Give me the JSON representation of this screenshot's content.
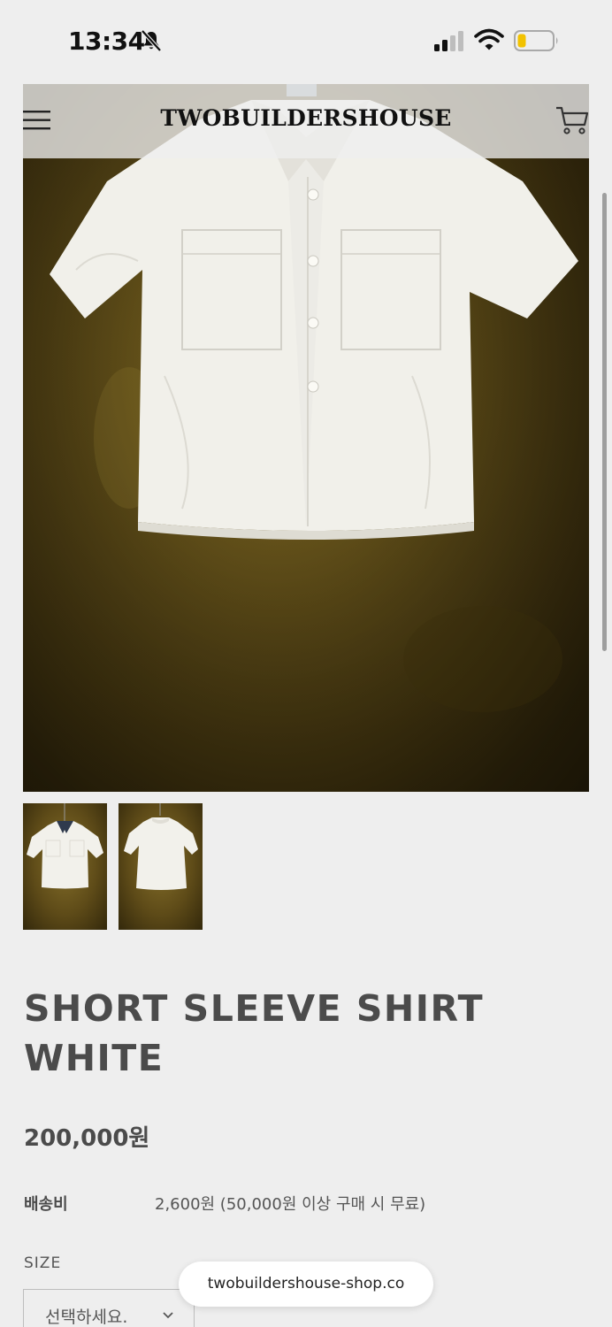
{
  "status_bar": {
    "time": "13:34",
    "icons": [
      "bell-slash-icon",
      "signal-icon",
      "wifi-icon",
      "battery-low-icon"
    ]
  },
  "header": {
    "brand": "TWOBUILDERSHOUSE",
    "menu_icon": "hamburger-menu-icon",
    "cart_icon": "cart-icon"
  },
  "product": {
    "title": "SHORT SLEEVE SHIRT WHITE",
    "price": "200,000원",
    "shipping_label": "배송비",
    "shipping_value": "2,600원 (50,000원 이상 구매 시 무료)",
    "size_label": "SIZE",
    "size_select_value": "선택하세요."
  },
  "browser": {
    "url": "twobuildershouse-shop.co"
  },
  "colors": {
    "background": "#eeeeee",
    "text": "#4b4b4b",
    "photo_backdrop": "#6f5a1c"
  }
}
